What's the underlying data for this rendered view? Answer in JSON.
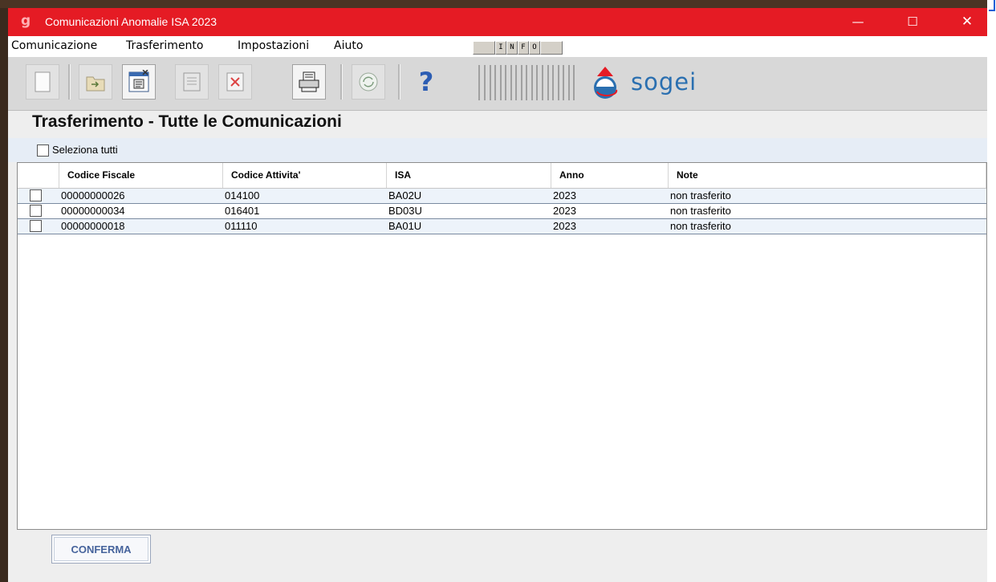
{
  "window": {
    "title": "Comunicazioni Anomalie ISA 2023",
    "app_icon_glyph": "g",
    "controls": {
      "minimize": "—",
      "maximize": "☐",
      "close": "✕"
    }
  },
  "menubar": {
    "items": [
      "Comunicazione",
      "Trasferimento",
      "Impostazioni",
      "Aiuto"
    ],
    "info_segments": [
      "",
      "I",
      "N",
      "F",
      "O",
      ""
    ]
  },
  "toolbar": {
    "buttons": [
      "new-icon",
      "import-icon",
      "form-icon",
      "save-icon",
      "delete-icon",
      "print-icon",
      "transfer-icon",
      "help-icon"
    ],
    "help_glyph": "?",
    "logo_text": "sogei"
  },
  "page": {
    "heading": "Trasferimento - Tutte le Comunicazioni",
    "select_all_label": "Seleziona tutti"
  },
  "table": {
    "columns": [
      "Codice Fiscale",
      "Codice Attivita'",
      "ISA",
      "Anno",
      "Note"
    ],
    "rows": [
      {
        "codice_fiscale": "00000000026",
        "codice_attivita": "014100",
        "isa": "BA02U",
        "anno": "2023",
        "note": "non trasferito"
      },
      {
        "codice_fiscale": "00000000034",
        "codice_attivita": "016401",
        "isa": "BD03U",
        "anno": "2023",
        "note": "non trasferito"
      },
      {
        "codice_fiscale": "00000000018",
        "codice_attivita": "011110",
        "isa": "BA01U",
        "anno": "2023",
        "note": "non trasferito"
      }
    ]
  },
  "footer": {
    "confirm_label": "CONFERMA"
  },
  "colors": {
    "titlebar": "#e51b24",
    "accent": "#2c5db3",
    "row_alt": "#edf3fa"
  }
}
